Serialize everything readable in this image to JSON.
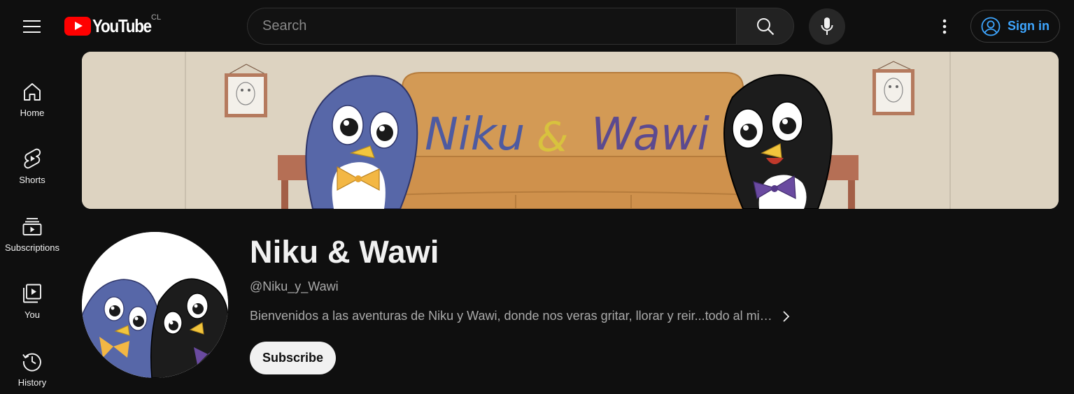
{
  "header": {
    "logo_text": "YouTube",
    "country_code": "CL",
    "search_placeholder": "Search",
    "signin_label": "Sign in"
  },
  "sidebar": {
    "items": [
      {
        "label": "Home",
        "icon": "home-icon"
      },
      {
        "label": "Shorts",
        "icon": "shorts-icon"
      },
      {
        "label": "Subscriptions",
        "icon": "subscriptions-icon"
      },
      {
        "label": "You",
        "icon": "you-icon"
      },
      {
        "label": "History",
        "icon": "history-icon"
      }
    ]
  },
  "banner": {
    "title_part1": "Niku",
    "ampersand": "&",
    "title_part2": "Wawi"
  },
  "channel": {
    "name": "Niku & Wawi",
    "handle": "@Niku_y_Wawi",
    "description": "Bienvenidos a las aventuras de Niku y Wawi, donde nos veras gritar, llorar y reir...todo al mi…",
    "subscribe_label": "Subscribe"
  },
  "colors": {
    "background": "#0f0f0f",
    "accent_link": "#3ea6ff",
    "youtube_red": "#ff0000",
    "banner_wall": "#ddd3c1",
    "sofa": "#d39a55",
    "niku_blue": "#5767a8",
    "wawi_black": "#1c1c1c",
    "banner_text_blue": "#4e5aa0",
    "banner_text_yellow": "#d8c23e",
    "banner_text_purple": "#5c4a8f"
  }
}
